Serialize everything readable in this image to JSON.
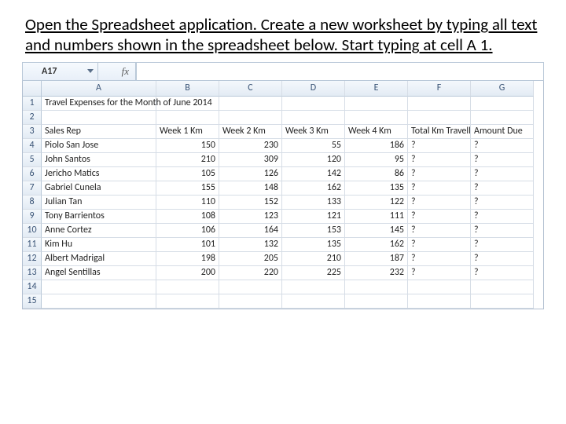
{
  "instruction": "Open the Spreadsheet application. Create a new worksheet by typing all text and numbers shown in the spreadsheet below. Start typing at cell A 1.",
  "namebox": {
    "value": "A17",
    "fx_label": "fx"
  },
  "columns": [
    "A",
    "B",
    "C",
    "D",
    "E",
    "F",
    "G"
  ],
  "row_numbers": [
    1,
    2,
    3,
    4,
    5,
    6,
    7,
    8,
    9,
    10,
    11,
    12,
    13,
    14,
    15
  ],
  "title_row": "Travel Expenses for the Month of June 2014",
  "headers": {
    "a": "Sales Rep",
    "b": "Week 1 Km",
    "c": "Week 2 Km",
    "d": "Week 3 Km",
    "e": "Week 4 Km",
    "f": "Total Km Travelled",
    "g": "Amount Due"
  },
  "rows": [
    {
      "name": "Piolo San Jose",
      "w1": 150,
      "w2": 230,
      "w3": 55,
      "w4": 186,
      "tot": "?",
      "amt": "?"
    },
    {
      "name": "John Santos",
      "w1": 210,
      "w2": 309,
      "w3": 120,
      "w4": 95,
      "tot": "?",
      "amt": "?"
    },
    {
      "name": "Jericho Matics",
      "w1": 105,
      "w2": 126,
      "w3": 142,
      "w4": 86,
      "tot": "?",
      "amt": "?"
    },
    {
      "name": "Gabriel Cunela",
      "w1": 155,
      "w2": 148,
      "w3": 162,
      "w4": 135,
      "tot": "?",
      "amt": "?"
    },
    {
      "name": "Julian Tan",
      "w1": 110,
      "w2": 152,
      "w3": 133,
      "w4": 122,
      "tot": "?",
      "amt": "?"
    },
    {
      "name": "Tony Barrientos",
      "w1": 108,
      "w2": 123,
      "w3": 121,
      "w4": 111,
      "tot": "?",
      "amt": "?"
    },
    {
      "name": "Anne Cortez",
      "w1": 106,
      "w2": 164,
      "w3": 153,
      "w4": 145,
      "tot": "?",
      "amt": "?"
    },
    {
      "name": "Kim Hu",
      "w1": 101,
      "w2": 132,
      "w3": 135,
      "w4": 162,
      "tot": "?",
      "amt": "?"
    },
    {
      "name": "Albert Madrigal",
      "w1": 198,
      "w2": 205,
      "w3": 210,
      "w4": 187,
      "tot": "?",
      "amt": "?"
    },
    {
      "name": "Angel Sentillas",
      "w1": 200,
      "w2": 220,
      "w3": 225,
      "w4": 232,
      "tot": "?",
      "amt": "?"
    }
  ],
  "chart_data": {
    "type": "table",
    "title": "Travel Expenses for the Month of June 2014",
    "columns": [
      "Sales Rep",
      "Week 1 Km",
      "Week 2 Km",
      "Week 3 Km",
      "Week 4 Km",
      "Total Km Travelled",
      "Amount Due"
    ],
    "data": [
      [
        "Piolo San Jose",
        150,
        230,
        55,
        186,
        "?",
        "?"
      ],
      [
        "John Santos",
        210,
        309,
        120,
        95,
        "?",
        "?"
      ],
      [
        "Jericho Matics",
        105,
        126,
        142,
        86,
        "?",
        "?"
      ],
      [
        "Gabriel Cunela",
        155,
        148,
        162,
        135,
        "?",
        "?"
      ],
      [
        "Julian Tan",
        110,
        152,
        133,
        122,
        "?",
        "?"
      ],
      [
        "Tony Barrientos",
        108,
        123,
        121,
        111,
        "?",
        "?"
      ],
      [
        "Anne Cortez",
        106,
        164,
        153,
        145,
        "?",
        "?"
      ],
      [
        "Kim Hu",
        101,
        132,
        135,
        162,
        "?",
        "?"
      ],
      [
        "Albert Madrigal",
        198,
        205,
        210,
        187,
        "?",
        "?"
      ],
      [
        "Angel Sentillas",
        200,
        220,
        225,
        232,
        "?",
        "?"
      ]
    ]
  }
}
